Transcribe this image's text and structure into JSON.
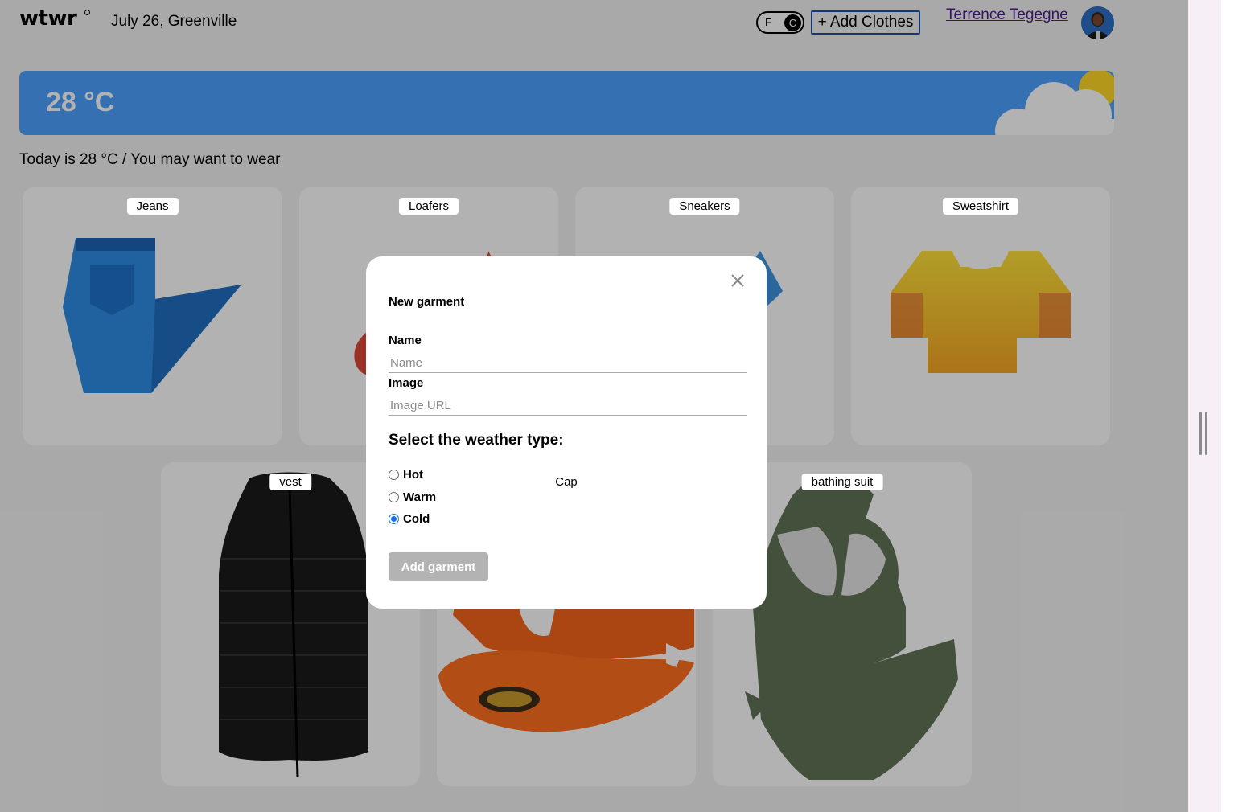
{
  "header": {
    "logo": "wtwr",
    "date_location": "July 26, Greenville",
    "unit_toggle": {
      "f": "F",
      "c": "C",
      "selected": "C"
    },
    "add_clothes_label": "+ Add Clothes",
    "username": "Terrence Tegegne"
  },
  "weather": {
    "temperature": "28 °C",
    "today_text": "Today is 28 °C / You may want to wear"
  },
  "cards": [
    {
      "name": "Jeans"
    },
    {
      "name": "Loafers"
    },
    {
      "name": "Sneakers"
    },
    {
      "name": "Sweatshirt"
    },
    {
      "name": "vest"
    },
    {
      "name": "Cap"
    },
    {
      "name": "bathing suit"
    }
  ],
  "modal": {
    "title": "New garment",
    "name_label": "Name",
    "name_placeholder": "Name",
    "image_label": "Image",
    "image_placeholder": "Image URL",
    "weather_legend": "Select the weather type:",
    "options": [
      {
        "label": "Hot",
        "checked": false
      },
      {
        "label": "Warm",
        "checked": false
      },
      {
        "label": "Cold",
        "checked": true
      }
    ],
    "submit_label": "Add garment"
  },
  "colors": {
    "weather_blue": "#4ca3ff",
    "radio_accent": "#1a73e8",
    "link_purple": "#4b1d92"
  }
}
